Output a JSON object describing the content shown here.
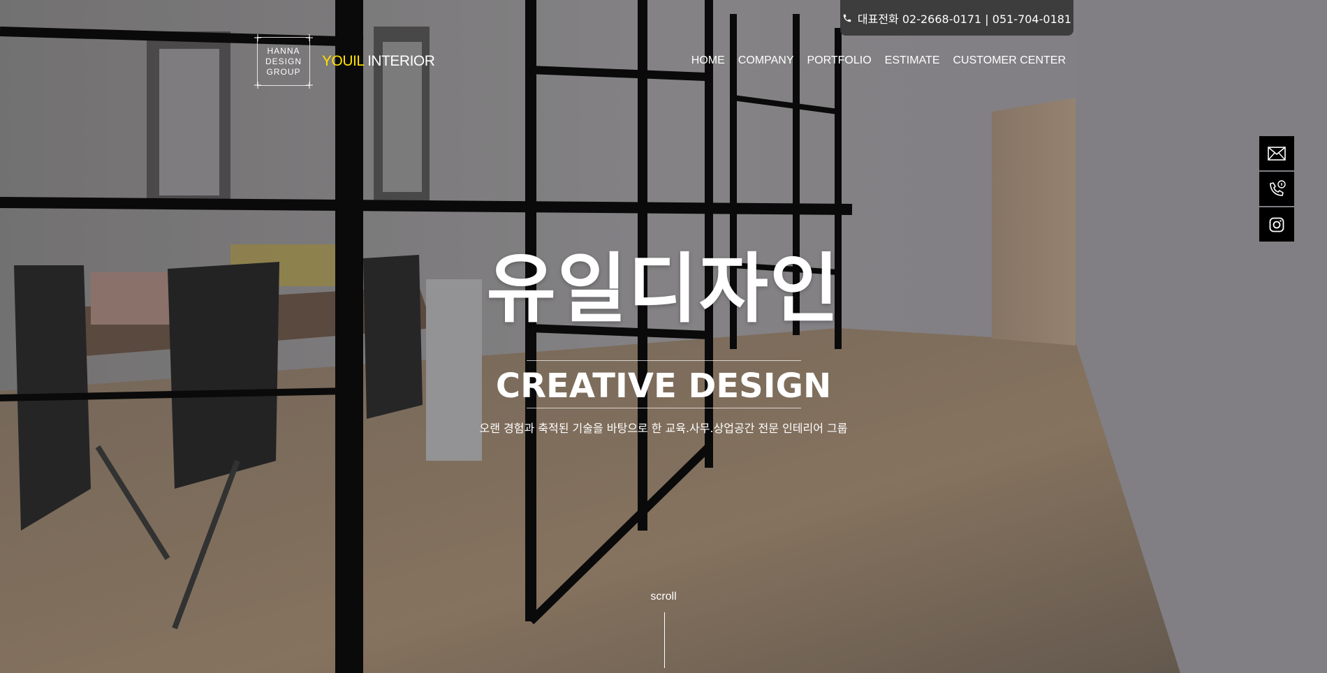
{
  "topbar": {
    "phone_text": "대표전화 02-2668-0171 | 051-704-0181"
  },
  "logo": {
    "line1": "HANNA",
    "line2": "DESIGN",
    "line3": "GROUP"
  },
  "brand": {
    "accent": "YOUIL",
    "rest": " INTERIOR"
  },
  "nav": [
    {
      "label": "HOME"
    },
    {
      "label": "COMPANY"
    },
    {
      "label": "PORTFOLIO"
    },
    {
      "label": "ESTIMATE"
    },
    {
      "label": "CUSTOMER CENTER"
    }
  ],
  "side_buttons": [
    {
      "icon": "mail-icon"
    },
    {
      "icon": "phone-info-icon"
    },
    {
      "icon": "instagram-icon"
    }
  ],
  "hero": {
    "title": "유일디자인",
    "subtitle": "CREATIVE DESIGN",
    "description": "오랜 경험과 축적된 기술을 바탕으로 한 교육.사무.상업공간 전문 인테리어 그룹",
    "scroll_label": "scroll"
  },
  "colors": {
    "accent_yellow": "#ffe100",
    "topbar_bg": "#373737",
    "side_button_bg": "#000000"
  }
}
